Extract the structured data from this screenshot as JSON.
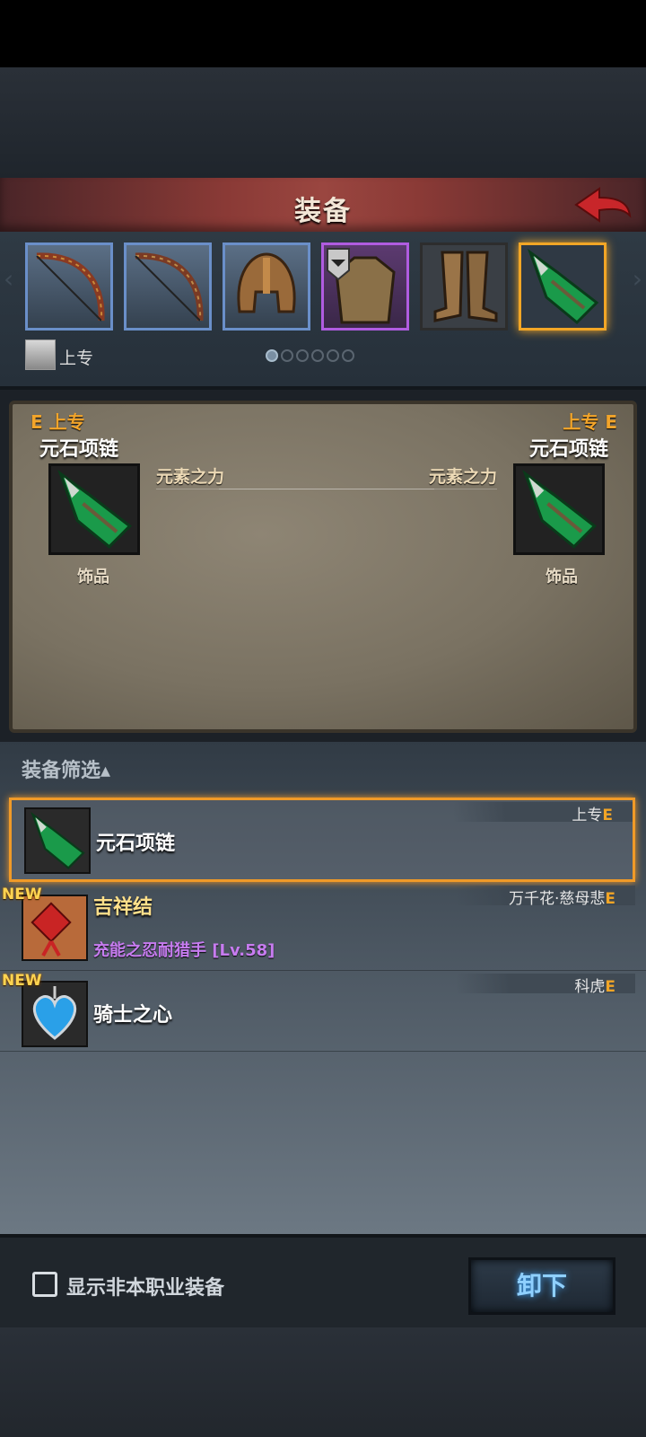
{
  "header": {
    "title": "装备"
  },
  "character": {
    "name": "上专"
  },
  "equip_slots": [
    {
      "name": "bow-1",
      "selected": false
    },
    {
      "name": "bow-2",
      "selected": false
    },
    {
      "name": "helmet",
      "selected": false
    },
    {
      "name": "armor",
      "selected": false
    },
    {
      "name": "boots",
      "selected": false
    },
    {
      "name": "necklace",
      "selected": true
    }
  ],
  "page_dots": {
    "count": 6,
    "active": 1
  },
  "compare": {
    "left": {
      "tag": "E 上专",
      "name": "元石项链",
      "stat": "元素之力",
      "category": "饰品"
    },
    "right": {
      "tag": "上专 E",
      "name": "元石项链",
      "stat": "元素之力",
      "category": "饰品"
    }
  },
  "list": {
    "filter_label": "装备筛选▴",
    "items": [
      {
        "name": "元石项链",
        "owner": "上专",
        "owner_suffix": "E",
        "new": "",
        "set": ""
      },
      {
        "name": "吉祥结",
        "owner": "万千花·慈母悲",
        "owner_suffix": "E",
        "new": "NEW",
        "set": "充能之忍耐猎手 [Lv.58]"
      },
      {
        "name": "骑士之心",
        "owner": "科虎",
        "owner_suffix": "E",
        "new": "NEW",
        "set": ""
      }
    ]
  },
  "footer": {
    "checkbox_label": "显示非本职业装备",
    "unequip_label": "卸下"
  },
  "colors": {
    "accent": "#f2a626",
    "epic": "#b05ce0",
    "rare": "#6a8fc9",
    "set_text": "#c77cf0"
  }
}
